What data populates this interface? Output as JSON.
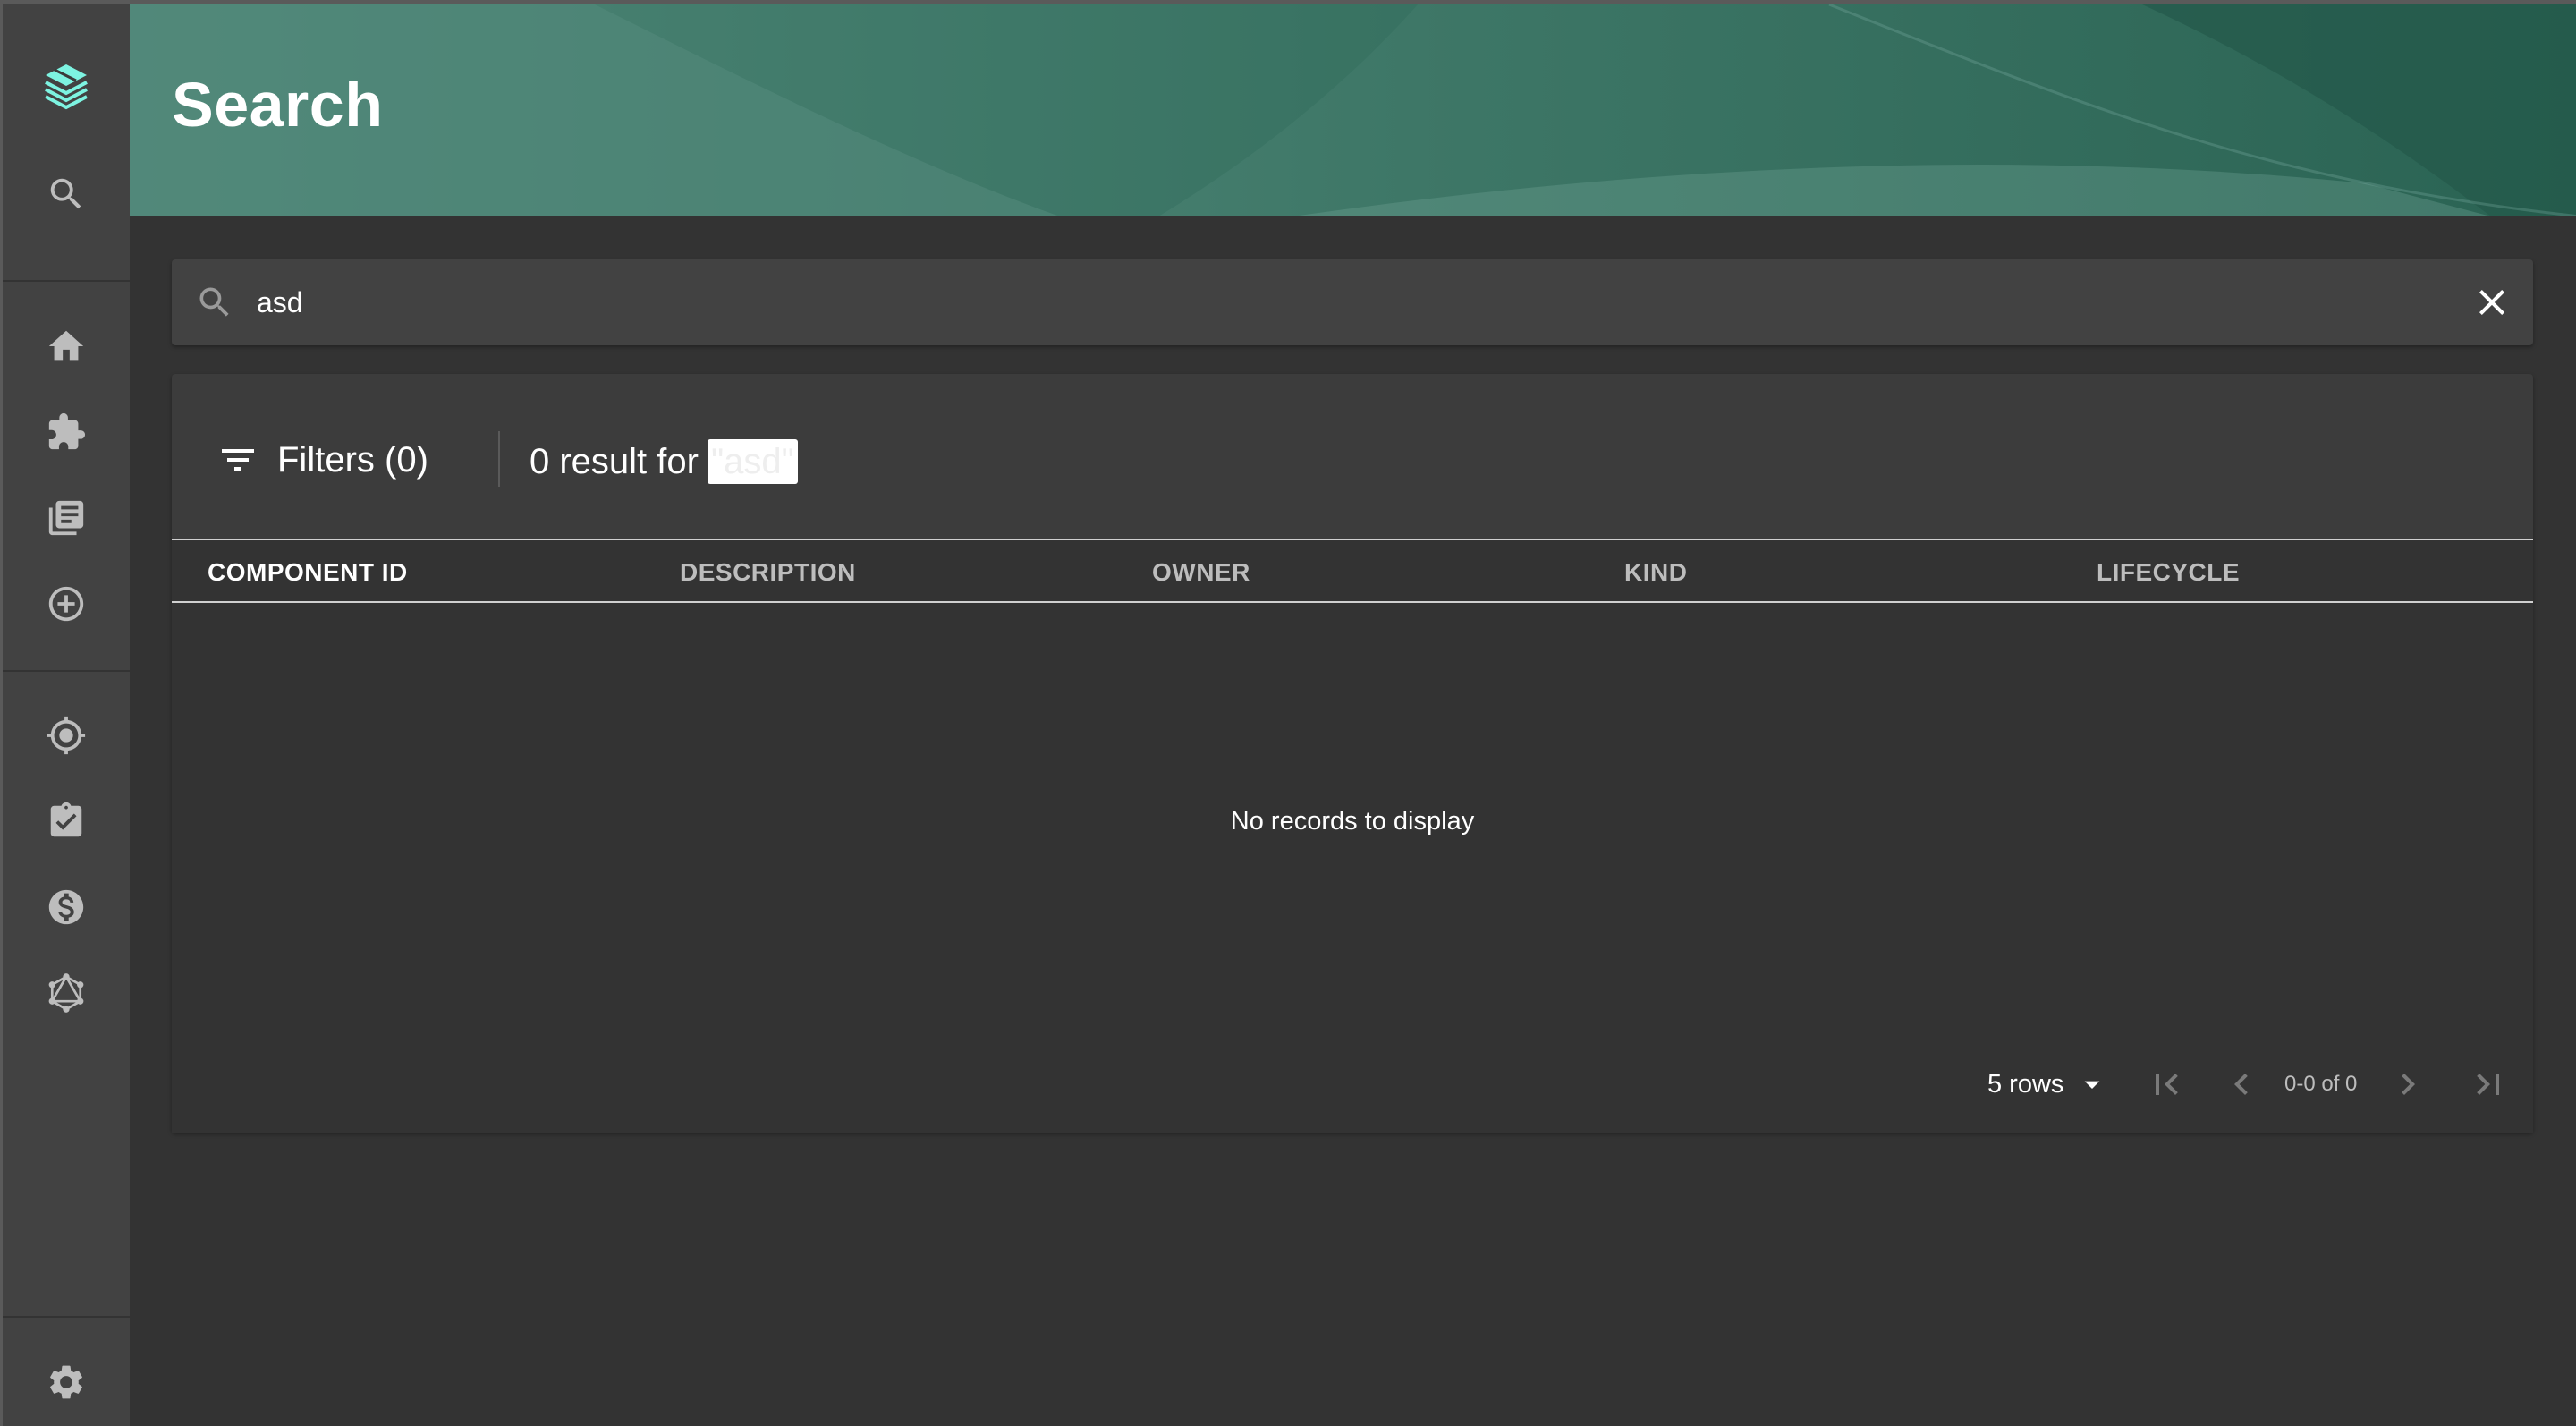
{
  "header": {
    "title": "Search"
  },
  "sidebar": {
    "icons": [
      "logo-icon",
      "search-icon",
      "home-icon",
      "puzzle-icon",
      "library-icon",
      "add-circle-icon",
      "target-icon",
      "checklist-icon",
      "dollar-icon",
      "graphql-icon",
      "gear-icon"
    ]
  },
  "search": {
    "value": "asd",
    "placeholder": "Search"
  },
  "results": {
    "filters_label": "Filters (0)",
    "result_prefix": "0 result for",
    "query_quoted": "\"asd\""
  },
  "table": {
    "columns": [
      "COMPONENT ID",
      "DESCRIPTION",
      "OWNER",
      "KIND",
      "LIFECYCLE"
    ],
    "rows": [],
    "empty_message": "No records to display"
  },
  "pagination": {
    "rows_per_page": "5 rows",
    "range": "0-0 of 0"
  },
  "colors": {
    "background": "#333333",
    "sidebar": "#424242",
    "header_accent": "#2f6656",
    "logo_accent": "#7df3e1"
  }
}
